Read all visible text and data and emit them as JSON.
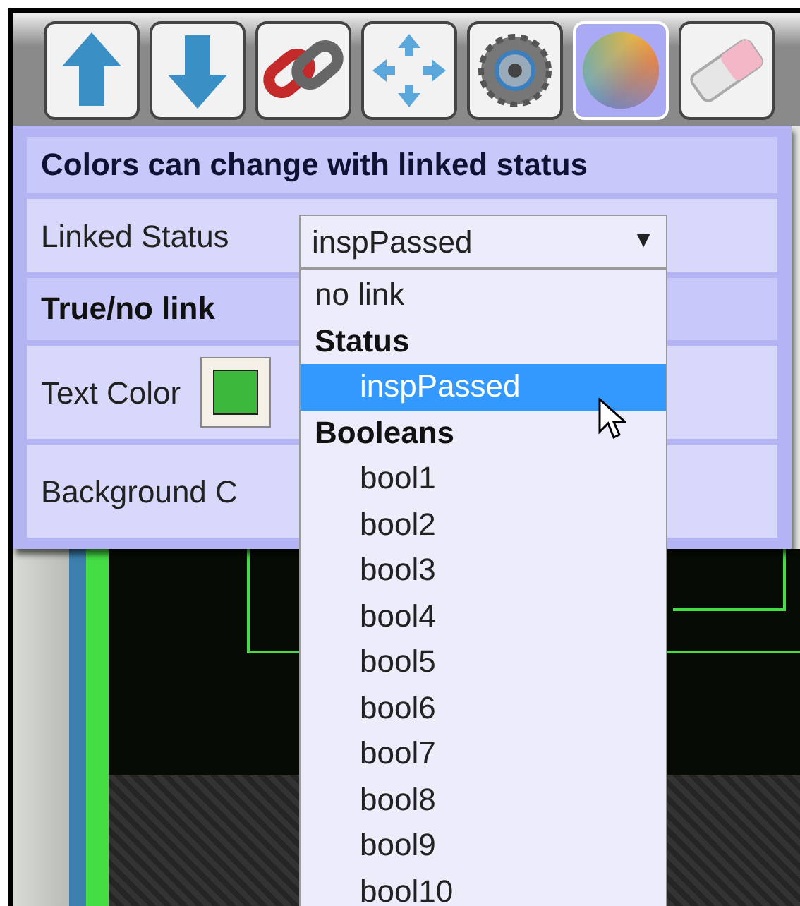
{
  "toolbar": [
    {
      "kind": "up",
      "selected": false
    },
    {
      "kind": "down",
      "selected": false
    },
    {
      "kind": "link",
      "selected": false
    },
    {
      "kind": "move",
      "selected": false
    },
    {
      "kind": "gear",
      "selected": false
    },
    {
      "kind": "color",
      "selected": true
    },
    {
      "kind": "eraser",
      "selected": false
    }
  ],
  "panel": {
    "title": "Colors can change with linked status",
    "linked_status": {
      "label": "Linked Status",
      "value": "inspPassed",
      "caret": "▼"
    },
    "section": "True/no link",
    "rows": [
      {
        "label": "Text Color",
        "color": "#3cb83c"
      },
      {
        "label": "Background C"
      }
    ]
  },
  "dropdown": [
    {
      "kind": "option",
      "label": "no link",
      "selected": false
    },
    {
      "kind": "group",
      "label": "Status",
      "children": [
        {
          "kind": "option",
          "label": "inspPassed",
          "selected": true
        }
      ]
    },
    {
      "kind": "group",
      "label": "Booleans",
      "children": [
        {
          "kind": "option",
          "label": "bool1",
          "selected": false
        },
        {
          "kind": "option",
          "label": "bool2",
          "selected": false
        },
        {
          "kind": "option",
          "label": "bool3",
          "selected": false
        },
        {
          "kind": "option",
          "label": "bool4",
          "selected": false
        },
        {
          "kind": "option",
          "label": "bool5",
          "selected": false
        },
        {
          "kind": "option",
          "label": "bool6",
          "selected": false
        },
        {
          "kind": "option",
          "label": "bool7",
          "selected": false
        },
        {
          "kind": "option",
          "label": "bool8",
          "selected": false
        },
        {
          "kind": "option",
          "label": "bool9",
          "selected": false
        },
        {
          "kind": "option",
          "label": "bool10",
          "selected": false
        }
      ]
    }
  ]
}
